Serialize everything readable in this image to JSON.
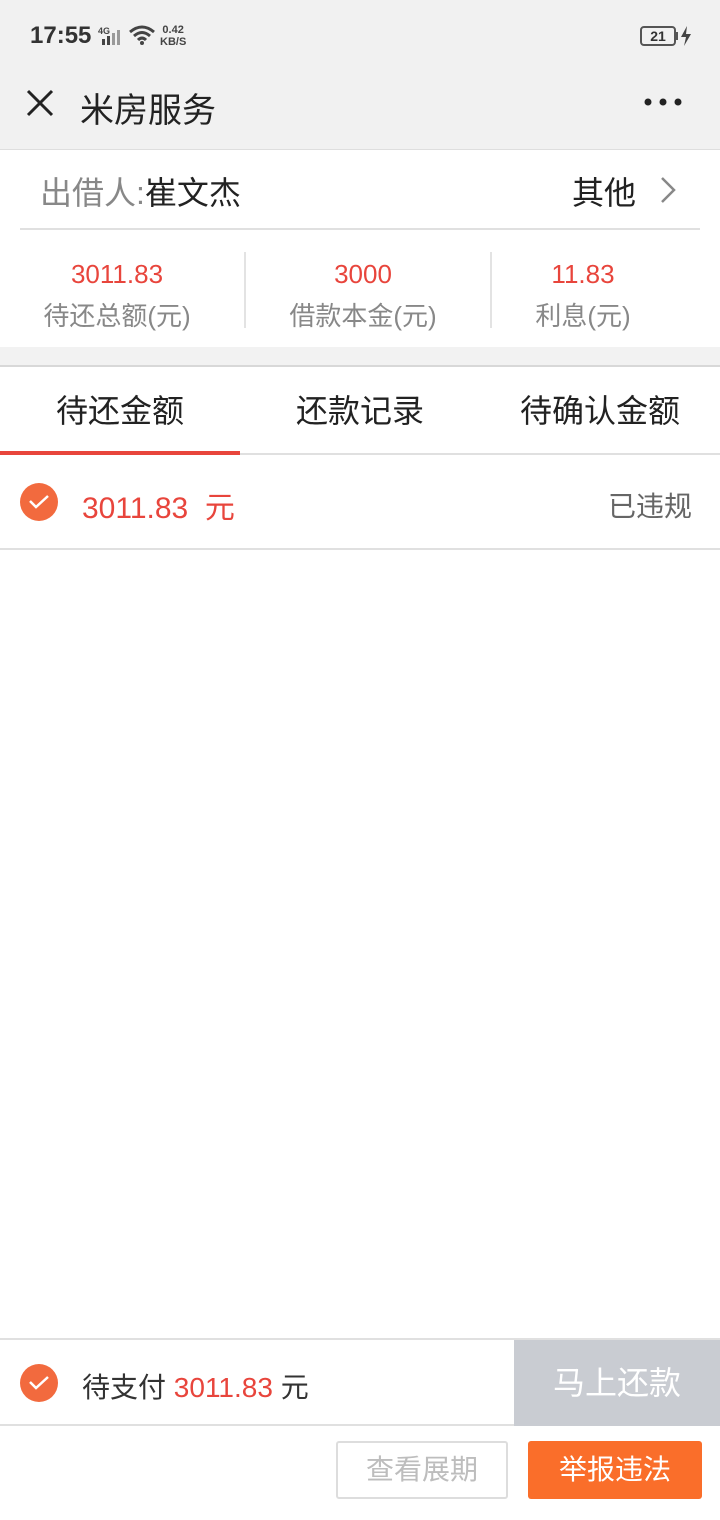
{
  "status": {
    "time": "17:55",
    "network": "4G",
    "speed_value": "0.42",
    "speed_unit": "KB/S",
    "battery": "21"
  },
  "nav": {
    "title": "米房服务",
    "close_icon": "close-icon",
    "more_icon": "more-icon"
  },
  "lender": {
    "label": "出借人:",
    "name": "崔文杰",
    "other": "其他"
  },
  "summary": {
    "total": {
      "value": "3011.83",
      "label": "待还总额(元)"
    },
    "principal": {
      "value": "3000",
      "label": "借款本金(元)"
    },
    "interest": {
      "value": "11.83",
      "label": "利息(元)"
    }
  },
  "tabs": [
    "待还金额",
    "还款记录",
    "待确认金额"
  ],
  "active_tab": 0,
  "item": {
    "amount": "3011.83",
    "unit": "元",
    "status": "已违规",
    "checked": true
  },
  "pay": {
    "prefix": "待支付",
    "amount": "3011.83",
    "unit": "元",
    "button": "马上还款"
  },
  "actions": {
    "extension": "查看展期",
    "report": "举报违法"
  },
  "colors": {
    "accent_red": "#e8453c",
    "check_orange": "#f26a3e",
    "report_orange": "#fa6e2a",
    "disabled_gray": "#c9ccd2"
  }
}
